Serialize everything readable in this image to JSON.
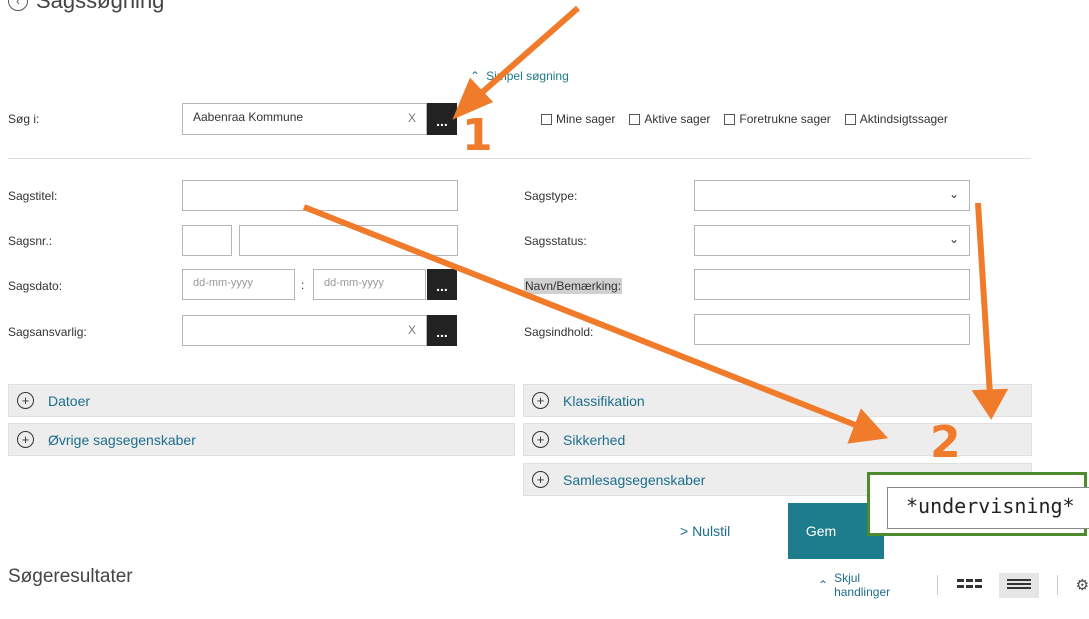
{
  "page": {
    "title": "Sagssøgning",
    "simple_search_link": "Simpel søgning"
  },
  "search_in": {
    "label": "Søg i:",
    "value": "Aabenraa Kommune",
    "clear": "X",
    "browse": "..."
  },
  "filters": [
    {
      "label": "Mine sager",
      "checked": false
    },
    {
      "label": "Aktive sager",
      "checked": false
    },
    {
      "label": "Foretrukne sager",
      "checked": false
    },
    {
      "label": "Aktindsigtssager",
      "checked": false
    }
  ],
  "left_fields": {
    "sagstitel": "Sagstitel:",
    "sagsnr": "Sagsnr.:",
    "sagsdato": "Sagsdato:",
    "date_from_placeholder": "dd-mm-yyyy",
    "date_sep": ":",
    "date_to_placeholder": "dd-mm-yyyy",
    "date_browse": "...",
    "sagsansvarlig": "Sagsansvarlig:",
    "sagsansvarlig_clear": "X",
    "sagsansvarlig_browse": "..."
  },
  "right_fields": {
    "sagstype": "Sagstype:",
    "sagsstatus": "Sagsstatus:",
    "navn": "Navn/Bemærking:",
    "sagsindhold": "Sagsindhold:"
  },
  "accordions_left": [
    "Datoer",
    "Øvrige sagsegenskaber"
  ],
  "accordions_right": [
    "Klassifikation",
    "Sikkerhed",
    "Samlesagsegenskaber"
  ],
  "actions": {
    "reset": "> Nulstil",
    "save": "Gem"
  },
  "callout": {
    "value": "*undervisning*"
  },
  "annotations": {
    "step1": "1",
    "step2": "2",
    "arrow_color": "#f07b2b"
  },
  "results": {
    "title": "Søgeresultater",
    "hide_actions": "Skjul handlinger"
  },
  "colors": {
    "accent": "#1e7d8c",
    "callout_border": "#4f8a2f"
  }
}
